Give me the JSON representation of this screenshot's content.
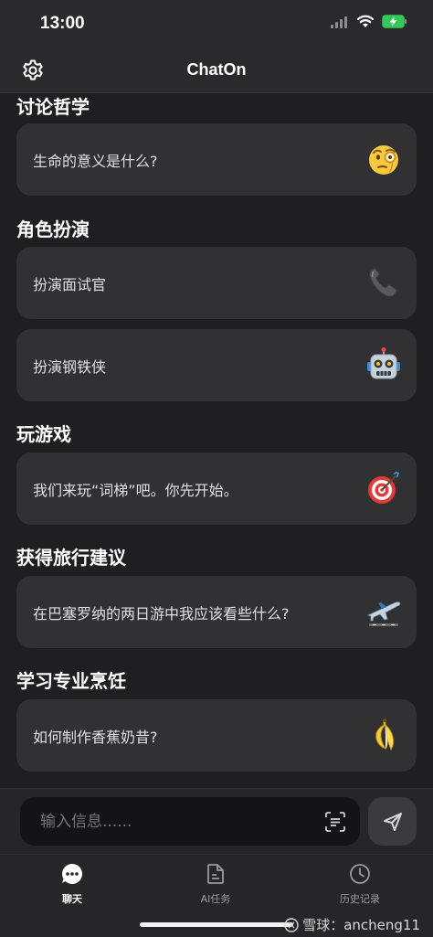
{
  "status_bar": {
    "time": "13:00"
  },
  "header": {
    "title": "ChatOn",
    "settings_icon": "gear-icon"
  },
  "sections": [
    {
      "title": "讨论哲学",
      "cards": [
        {
          "label": "生命的意义是什么?",
          "icon": "monocle-face-emoji"
        }
      ]
    },
    {
      "title": "角色扮演",
      "cards": [
        {
          "label": "扮演面试官",
          "icon": "telephone-receiver-emoji"
        },
        {
          "label": "扮演钢铁侠",
          "icon": "robot-emoji"
        }
      ]
    },
    {
      "title": "玩游戏",
      "cards": [
        {
          "label": "我们来玩“词梯”吧。你先开始。",
          "icon": "direct-hit-emoji"
        }
      ]
    },
    {
      "title": "获得旅行建议",
      "cards": [
        {
          "label": "在巴塞罗纳的两日游中我应该看些什么?",
          "icon": "airplane-departure-emoji"
        }
      ]
    },
    {
      "title": "学习专业烹饪",
      "cards": [
        {
          "label": "如何制作香蕉奶昔?",
          "icon": "banana-emoji"
        }
      ]
    }
  ],
  "input": {
    "placeholder": "输入信息......"
  },
  "tabs": [
    {
      "label": "聊天",
      "icon": "chat-bubble-icon",
      "active": true
    },
    {
      "label": "AI任务",
      "icon": "document-icon",
      "active": false
    },
    {
      "label": "历史记录",
      "icon": "clock-icon",
      "active": false
    }
  ],
  "watermark": {
    "text": "雪球：ancheng11"
  }
}
